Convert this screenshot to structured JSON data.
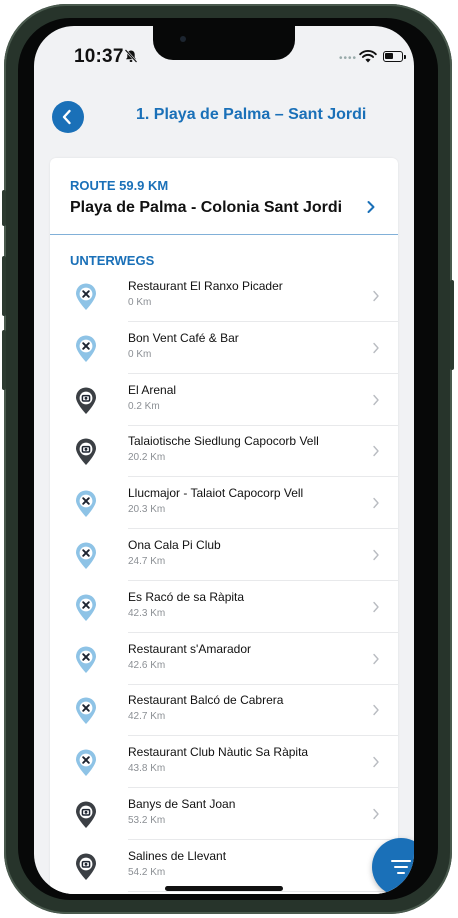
{
  "status_bar": {
    "time": "10:37"
  },
  "header": {
    "title": "1. Playa de Palma – Sant Jordi",
    "back_icon": "chevron-left-icon"
  },
  "route": {
    "label": "ROUTE 59.9 KM",
    "name": "Playa de Palma - Colonia Sant Jordi"
  },
  "section": {
    "title": "UNTERWEGS"
  },
  "items": [
    {
      "name": "Restaurant El Ranxo Picader",
      "distance": "0 Km",
      "icon": "restaurant-pin-icon"
    },
    {
      "name": "Bon Vent Café & Bar",
      "distance": "0 Km",
      "icon": "restaurant-pin-icon"
    },
    {
      "name": "El Arenal",
      "distance": "0.2 Km",
      "icon": "sight-pin-icon"
    },
    {
      "name": "Talaiotische Siedlung Capocorb Vell",
      "distance": "20.2 Km",
      "icon": "sight-pin-icon"
    },
    {
      "name": "Llucmajor - Talaiot Capocorp Vell",
      "distance": "20.3 Km",
      "icon": "restaurant-pin-icon"
    },
    {
      "name": "Ona Cala Pi Club",
      "distance": "24.7 Km",
      "icon": "restaurant-pin-icon"
    },
    {
      "name": "Es Racó de sa Ràpita",
      "distance": "42.3 Km",
      "icon": "restaurant-pin-icon"
    },
    {
      "name": "Restaurant s'Amarador",
      "distance": "42.6 Km",
      "icon": "restaurant-pin-icon"
    },
    {
      "name": "Restaurant Balcó de Cabrera",
      "distance": "42.7 Km",
      "icon": "restaurant-pin-icon"
    },
    {
      "name": "Restaurant Club Nàutic Sa Ràpita",
      "distance": "43.8 Km",
      "icon": "restaurant-pin-icon"
    },
    {
      "name": "Banys de Sant Joan",
      "distance": "53.2 Km",
      "icon": "sight-pin-icon"
    },
    {
      "name": "Salines de Llevant",
      "distance": "54.2 Km",
      "icon": "sight-pin-icon"
    }
  ],
  "colors": {
    "accent": "#1a70b8",
    "restaurant_pin": "#8ec3e6",
    "sight_pin": "#3b3f44"
  }
}
